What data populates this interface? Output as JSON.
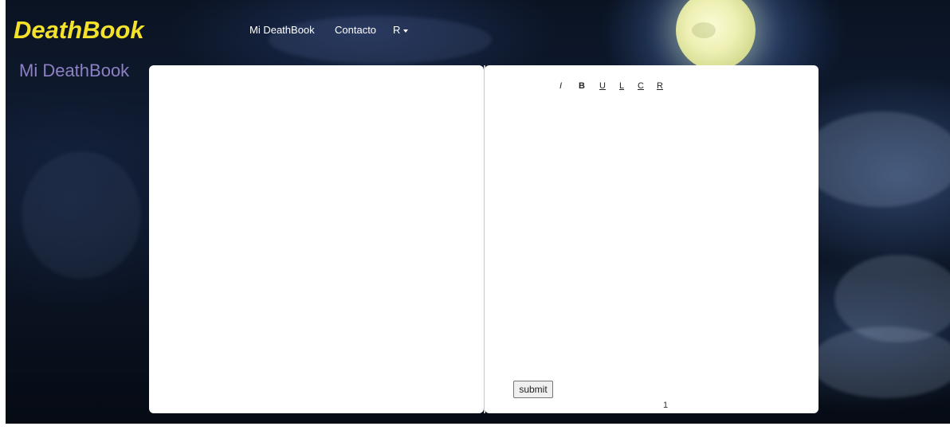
{
  "brand": "DeathBook",
  "nav": {
    "items": [
      "Mi DeathBook",
      "Contacto"
    ],
    "user_menu_label": "R"
  },
  "section_title": "Mi DeathBook",
  "editor": {
    "toolbar": [
      "I",
      "B",
      "U",
      "L",
      "C",
      "R"
    ],
    "submit_label": "submit",
    "page_number": "1"
  },
  "colors": {
    "brand": "#f4e12b",
    "section_title": "#8d80c4"
  }
}
